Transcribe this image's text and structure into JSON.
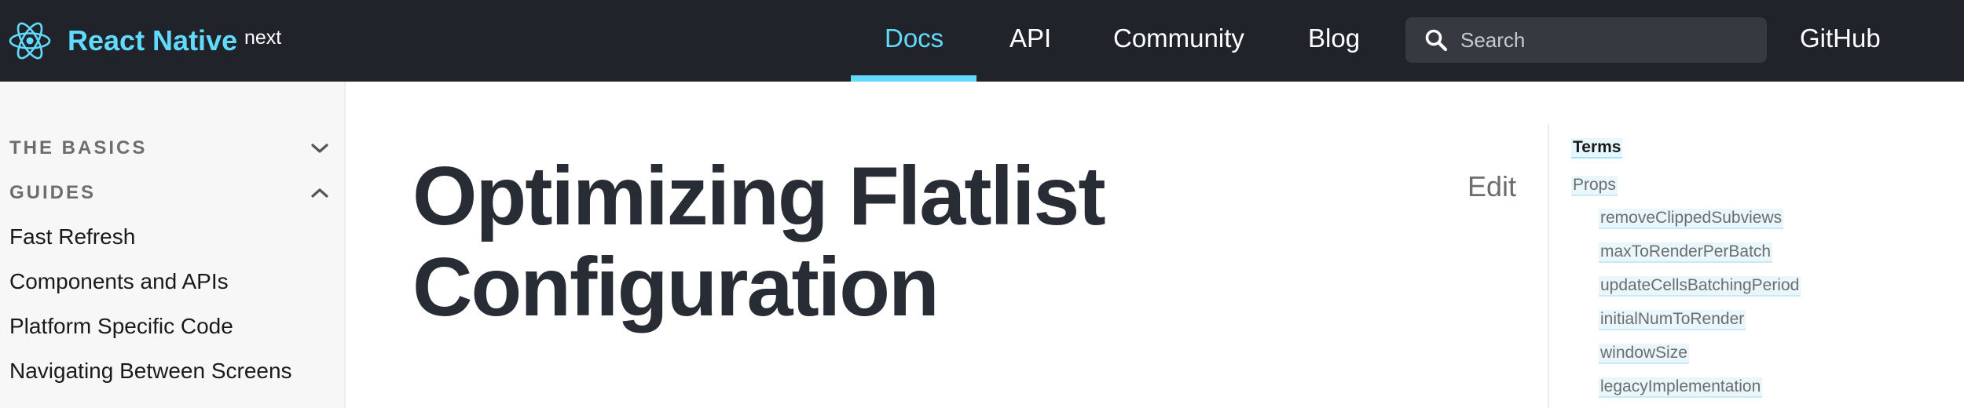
{
  "navbar": {
    "brand": "React Native",
    "version": "next",
    "links": [
      {
        "label": "Docs",
        "active": true
      },
      {
        "label": "API",
        "active": false
      },
      {
        "label": "Community",
        "active": false
      },
      {
        "label": "Blog",
        "active": false
      }
    ],
    "search_placeholder": "Search",
    "github": "GitHub"
  },
  "sidebar": {
    "sections": [
      {
        "label": "THE BASICS",
        "expanded": false
      },
      {
        "label": "GUIDES",
        "expanded": true
      }
    ],
    "items": [
      "Fast Refresh",
      "Components and APIs",
      "Platform Specific Code",
      "Navigating Between Screens"
    ]
  },
  "main": {
    "title_line1": "Optimizing Flatlist",
    "title_line2": "Configuration",
    "edit": "Edit"
  },
  "toc": {
    "heading": "Terms",
    "props": "Props",
    "items": [
      "removeClippedSubviews",
      "maxToRenderPerBatch",
      "updateCellsBatchingPeriod",
      "initialNumToRender",
      "windowSize",
      "legacyImplementation"
    ]
  },
  "colors": {
    "navbar_bg": "#20232a",
    "accent": "#61dafb",
    "title_text": "#282c34",
    "sidebar_bg": "#f7f7f7"
  },
  "icons": {
    "logo": "react-atom-icon",
    "search": "magnifier-icon",
    "collapsed_section": "chevron-down-icon",
    "expanded_section": "chevron-up-icon"
  }
}
